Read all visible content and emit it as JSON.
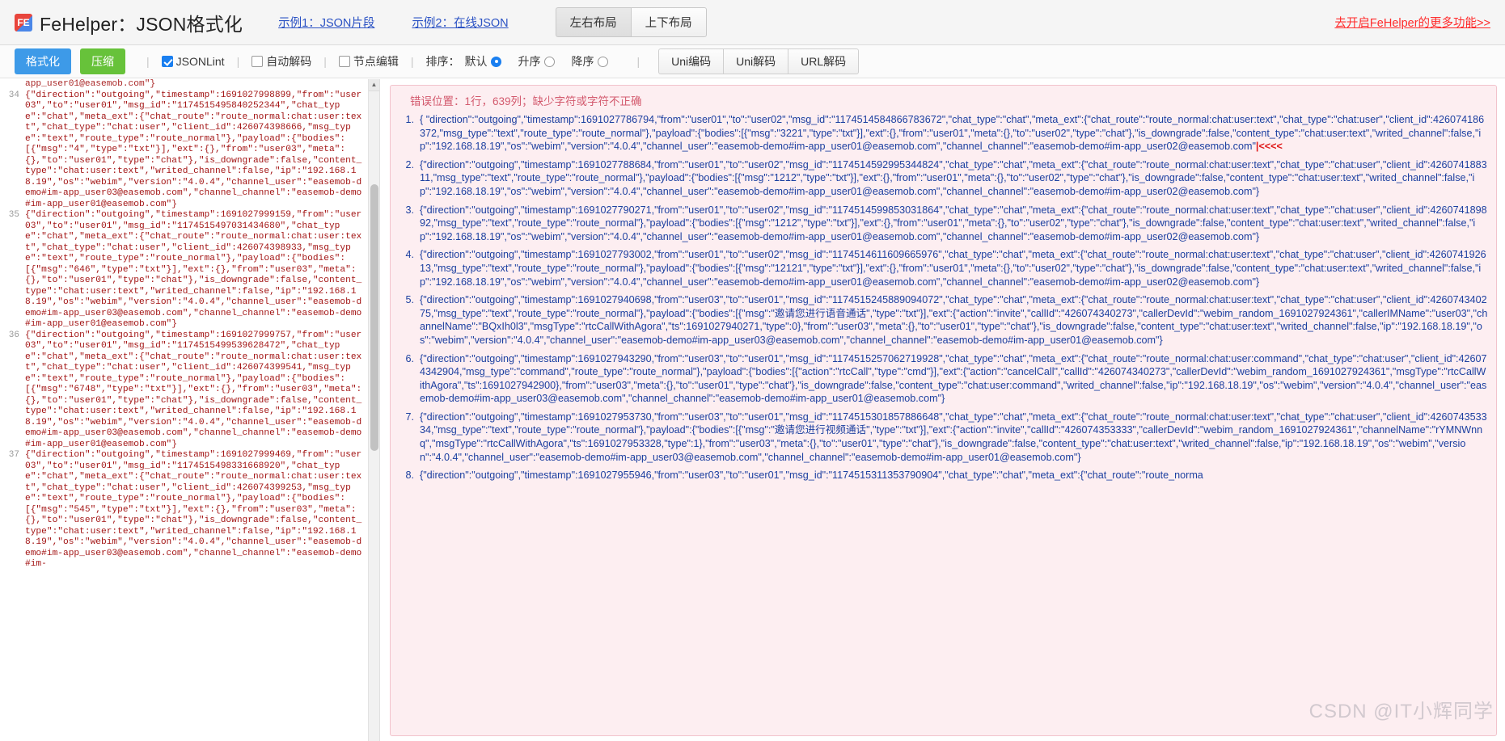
{
  "header": {
    "logo_text": "FE",
    "title": "FeHelper：JSON格式化",
    "links": [
      {
        "label": "示例1：JSON片段"
      },
      {
        "label": "示例2：在线JSON"
      }
    ],
    "layout_buttons": [
      {
        "label": "左右布局",
        "active": true
      },
      {
        "label": "上下布局",
        "active": false
      }
    ],
    "more_link": "去开启FeHelper的更多功能>>",
    "more_link_color": "#ff2a2a"
  },
  "toolbar": {
    "format_label": "格式化",
    "compress_label": "压缩",
    "format_color": "#3d9ae8",
    "compress_color": "#67c23a",
    "separator": "|",
    "checkboxes": [
      {
        "label": "JSONLint",
        "checked": true
      },
      {
        "label": "自动解码",
        "checked": false
      },
      {
        "label": "节点编辑",
        "checked": false
      }
    ],
    "sort_label": "排序：",
    "sort_options": [
      {
        "label": "默认",
        "selected": true
      },
      {
        "label": "升序",
        "selected": false
      },
      {
        "label": "降序",
        "selected": false
      }
    ],
    "encode_buttons": [
      {
        "label": "Uni编码"
      },
      {
        "label": "Uni解码"
      },
      {
        "label": "URL解码"
      }
    ]
  },
  "left_panel": {
    "partial_top_line": "app_user01@easemob.com\"}",
    "lines": [
      {
        "number": "34",
        "text": "{\"direction\":\"outgoing\",\"timestamp\":1691027998899,\"from\":\"user03\",\"to\":\"user01\",\"msg_id\":\"1174515495840252344\",\"chat_type\":\"chat\",\"meta_ext\":{\"chat_route\":\"route_normal:chat:user:text\",\"chat_type\":\"chat:user\",\"client_id\":426074398666,\"msg_type\":\"text\",\"route_type\":\"route_normal\"},\"payload\":{\"bodies\":[{\"msg\":\"4\",\"type\":\"txt\"}],\"ext\":{},\"from\":\"user03\",\"meta\":{},\"to\":\"user01\",\"type\":\"chat\"},\"is_downgrade\":false,\"content_type\":\"chat:user:text\",\"writed_channel\":false,\"ip\":\"192.168.18.19\",\"os\":\"webim\",\"version\":\"4.0.4\",\"channel_user\":\"easemob-demo#im-app_user03@easemob.com\",\"channel_channel\":\"easemob-demo#im-app_user01@easemob.com\"}"
      },
      {
        "number": "35",
        "text": "{\"direction\":\"outgoing\",\"timestamp\":1691027999159,\"from\":\"user03\",\"to\":\"user01\",\"msg_id\":\"1174515497031434680\",\"chat_type\":\"chat\",\"meta_ext\":{\"chat_route\":\"route_normal:chat:user:text\",\"chat_type\":\"chat:user\",\"client_id\":426074398933,\"msg_type\":\"text\",\"route_type\":\"route_normal\"},\"payload\":{\"bodies\":[{\"msg\":\"646\",\"type\":\"txt\"}],\"ext\":{},\"from\":\"user03\",\"meta\":{},\"to\":\"user01\",\"type\":\"chat\"},\"is_downgrade\":false,\"content_type\":\"chat:user:text\",\"writed_channel\":false,\"ip\":\"192.168.18.19\",\"os\":\"webim\",\"version\":\"4.0.4\",\"channel_user\":\"easemob-demo#im-app_user03@easemob.com\",\"channel_channel\":\"easemob-demo#im-app_user01@easemob.com\"}"
      },
      {
        "number": "36",
        "text": "{\"direction\":\"outgoing\",\"timestamp\":1691027999757,\"from\":\"user03\",\"to\":\"user01\",\"msg_id\":\"1174515499539628472\",\"chat_type\":\"chat\",\"meta_ext\":{\"chat_route\":\"route_normal:chat:user:text\",\"chat_type\":\"chat:user\",\"client_id\":426074399541,\"msg_type\":\"text\",\"route_type\":\"route_normal\"},\"payload\":{\"bodies\":[{\"msg\":\"6748\",\"type\":\"txt\"}],\"ext\":{},\"from\":\"user03\",\"meta\":{},\"to\":\"user01\",\"type\":\"chat\"},\"is_downgrade\":false,\"content_type\":\"chat:user:text\",\"writed_channel\":false,\"ip\":\"192.168.18.19\",\"os\":\"webim\",\"version\":\"4.0.4\",\"channel_user\":\"easemob-demo#im-app_user03@easemob.com\",\"channel_channel\":\"easemob-demo#im-app_user01@easemob.com\"}"
      },
      {
        "number": "37",
        "text": "{\"direction\":\"outgoing\",\"timestamp\":1691027999469,\"from\":\"user03\",\"to\":\"user01\",\"msg_id\":\"1174515498331668920\",\"chat_type\":\"chat\",\"meta_ext\":{\"chat_route\":\"route_normal:chat:user:text\",\"chat_type\":\"chat:user\",\"client_id\":426074399253,\"msg_type\":\"text\",\"route_type\":\"route_normal\"},\"payload\":{\"bodies\":[{\"msg\":\"545\",\"type\":\"txt\"}],\"ext\":{},\"from\":\"user03\",\"meta\":{},\"to\":\"user01\",\"type\":\"chat\"},\"is_downgrade\":false,\"content_type\":\"chat:user:text\",\"writed_channel\":false,\"ip\":\"192.168.18.19\",\"os\":\"webim\",\"version\":\"4.0.4\",\"channel_user\":\"easemob-demo#im-app_user03@easemob.com\",\"channel_channel\":\"easemob-demo#im-"
      }
    ],
    "scrollbar": {
      "up_arrow": "▲",
      "down_arrow": "▼"
    }
  },
  "right_panel": {
    "error_message": "错误位置：1行，639列；缺少字符或字符不正确",
    "error_marker": "|<<<<",
    "items": [
      {
        "index": "1.",
        "text": "{ \"direction\":\"outgoing\",\"timestamp\":1691027786794,\"from\":\"user01\",\"to\":\"user02\",\"msg_id\":\"1174514584866783672\",\"chat_type\":\"chat\",\"meta_ext\":{\"chat_route\":\"route_normal:chat:user:text\",\"chat_type\":\"chat:user\",\"client_id\":426074186372,\"msg_type\":\"text\",\"route_type\":\"route_normal\"},\"payload\":{\"bodies\":[{\"msg\":\"3221\",\"type\":\"txt\"}],\"ext\":{},\"from\":\"user01\",\"meta\":{},\"to\":\"user02\",\"type\":\"chat\"},\"is_downgrade\":false,\"content_type\":\"chat:user:text\",\"writed_channel\":false,\"ip\":\"192.168.18.19\",\"os\":\"webim\",\"version\":\"4.0.4\",\"channel_user\":\"easemob-demo#im-app_user01@easemob.com\",\"channel_channel\":\"easemob-demo#im-app_user02@easemob.com\"",
        "has_marker": true
      },
      {
        "index": "2.",
        "text": "{\"direction\":\"outgoing\",\"timestamp\":1691027788684,\"from\":\"user01\",\"to\":\"user02\",\"msg_id\":\"1174514592995344824\",\"chat_type\":\"chat\",\"meta_ext\":{\"chat_route\":\"route_normal:chat:user:text\",\"chat_type\":\"chat:user\",\"client_id\":426074188311,\"msg_type\":\"text\",\"route_type\":\"route_normal\"},\"payload\":{\"bodies\":[{\"msg\":\"1212\",\"type\":\"txt\"}],\"ext\":{},\"from\":\"user01\",\"meta\":{},\"to\":\"user02\",\"type\":\"chat\"},\"is_downgrade\":false,\"content_type\":\"chat:user:text\",\"writed_channel\":false,\"ip\":\"192.168.18.19\",\"os\":\"webim\",\"version\":\"4.0.4\",\"channel_user\":\"easemob-demo#im-app_user01@easemob.com\",\"channel_channel\":\"easemob-demo#im-app_user02@easemob.com\"}",
        "has_marker": false
      },
      {
        "index": "3.",
        "text": "{\"direction\":\"outgoing\",\"timestamp\":1691027790271,\"from\":\"user01\",\"to\":\"user02\",\"msg_id\":\"1174514599853031864\",\"chat_type\":\"chat\",\"meta_ext\":{\"chat_route\":\"route_normal:chat:user:text\",\"chat_type\":\"chat:user\",\"client_id\":426074189892,\"msg_type\":\"text\",\"route_type\":\"route_normal\"},\"payload\":{\"bodies\":[{\"msg\":\"1212\",\"type\":\"txt\"}],\"ext\":{},\"from\":\"user01\",\"meta\":{},\"to\":\"user02\",\"type\":\"chat\"},\"is_downgrade\":false,\"content_type\":\"chat:user:text\",\"writed_channel\":false,\"ip\":\"192.168.18.19\",\"os\":\"webim\",\"version\":\"4.0.4\",\"channel_user\":\"easemob-demo#im-app_user01@easemob.com\",\"channel_channel\":\"easemob-demo#im-app_user02@easemob.com\"}",
        "has_marker": false
      },
      {
        "index": "4.",
        "text": "{\"direction\":\"outgoing\",\"timestamp\":1691027793002,\"from\":\"user01\",\"to\":\"user02\",\"msg_id\":\"1174514611609665976\",\"chat_type\":\"chat\",\"meta_ext\":{\"chat_route\":\"route_normal:chat:user:text\",\"chat_type\":\"chat:user\",\"client_id\":426074192613,\"msg_type\":\"text\",\"route_type\":\"route_normal\"},\"payload\":{\"bodies\":[{\"msg\":\"12121\",\"type\":\"txt\"}],\"ext\":{},\"from\":\"user01\",\"meta\":{},\"to\":\"user02\",\"type\":\"chat\"},\"is_downgrade\":false,\"content_type\":\"chat:user:text\",\"writed_channel\":false,\"ip\":\"192.168.18.19\",\"os\":\"webim\",\"version\":\"4.0.4\",\"channel_user\":\"easemob-demo#im-app_user01@easemob.com\",\"channel_channel\":\"easemob-demo#im-app_user02@easemob.com\"}",
        "has_marker": false
      },
      {
        "index": "5.",
        "text": "{\"direction\":\"outgoing\",\"timestamp\":1691027940698,\"from\":\"user03\",\"to\":\"user01\",\"msg_id\":\"1174515245889094072\",\"chat_type\":\"chat\",\"meta_ext\":{\"chat_route\":\"route_normal:chat:user:text\",\"chat_type\":\"chat:user\",\"client_id\":426074340275,\"msg_type\":\"text\",\"route_type\":\"route_normal\"},\"payload\":{\"bodies\":[{\"msg\":\"邀请您进行语音通话\",\"type\":\"txt\"}],\"ext\":{\"action\":\"invite\",\"callId\":\"426074340273\",\"callerDevId\":\"webim_random_1691027924361\",\"callerIMName\":\"user03\",\"channelName\":\"BQxIh0l3\",\"msgType\":\"rtcCallWithAgora\",\"ts\":1691027940271,\"type\":0},\"from\":\"user03\",\"meta\":{},\"to\":\"user01\",\"type\":\"chat\"},\"is_downgrade\":false,\"content_type\":\"chat:user:text\",\"writed_channel\":false,\"ip\":\"192.168.18.19\",\"os\":\"webim\",\"version\":\"4.0.4\",\"channel_user\":\"easemob-demo#im-app_user03@easemob.com\",\"channel_channel\":\"easemob-demo#im-app_user01@easemob.com\"}",
        "has_marker": false
      },
      {
        "index": "6.",
        "text": "{\"direction\":\"outgoing\",\"timestamp\":1691027943290,\"from\":\"user03\",\"to\":\"user01\",\"msg_id\":\"1174515257062719928\",\"chat_type\":\"chat\",\"meta_ext\":{\"chat_route\":\"route_normal:chat:user:command\",\"chat_type\":\"chat:user\",\"client_id\":426074342904,\"msg_type\":\"command\",\"route_type\":\"route_normal\"},\"payload\":{\"bodies\":[{\"action\":\"rtcCall\",\"type\":\"cmd\"}],\"ext\":{\"action\":\"cancelCall\",\"callId\":\"426074340273\",\"callerDevId\":\"webim_random_1691027924361\",\"msgType\":\"rtcCallWithAgora\",\"ts\":1691027942900},\"from\":\"user03\",\"meta\":{},\"to\":\"user01\",\"type\":\"chat\"},\"is_downgrade\":false,\"content_type\":\"chat:user:command\",\"writed_channel\":false,\"ip\":\"192.168.18.19\",\"os\":\"webim\",\"version\":\"4.0.4\",\"channel_user\":\"easemob-demo#im-app_user03@easemob.com\",\"channel_channel\":\"easemob-demo#im-app_user01@easemob.com\"}",
        "has_marker": false
      },
      {
        "index": "7.",
        "text": "{\"direction\":\"outgoing\",\"timestamp\":1691027953730,\"from\":\"user03\",\"to\":\"user01\",\"msg_id\":\"1174515301857886648\",\"chat_type\":\"chat\",\"meta_ext\":{\"chat_route\":\"route_normal:chat:user:text\",\"chat_type\":\"chat:user\",\"client_id\":426074353334,\"msg_type\":\"text\",\"route_type\":\"route_normal\"},\"payload\":{\"bodies\":[{\"msg\":\"邀请您进行视频通话\",\"type\":\"txt\"}],\"ext\":{\"action\":\"invite\",\"callId\":\"426074353333\",\"callerDevId\":\"webim_random_1691027924361\",\"channelName\":\"rYMNWnnq\",\"msgType\":\"rtcCallWithAgora\",\"ts\":1691027953328,\"type\":1},\"from\":\"user03\",\"meta\":{},\"to\":\"user01\",\"type\":\"chat\"},\"is_downgrade\":false,\"content_type\":\"chat:user:text\",\"writed_channel\":false,\"ip\":\"192.168.18.19\",\"os\":\"webim\",\"version\":\"4.0.4\",\"channel_user\":\"easemob-demo#im-app_user03@easemob.com\",\"channel_channel\":\"easemob-demo#im-app_user01@easemob.com\"}",
        "has_marker": false
      },
      {
        "index": "8.",
        "text": "{\"direction\":\"outgoing\",\"timestamp\":1691027955946,\"from\":\"user03\",\"to\":\"user01\",\"msg_id\":\"1174515311353790904\",\"chat_type\":\"chat\",\"meta_ext\":{\"chat_route\":\"route_norma",
        "has_marker": false
      }
    ]
  },
  "watermark": "CSDN @IT小辉同学"
}
